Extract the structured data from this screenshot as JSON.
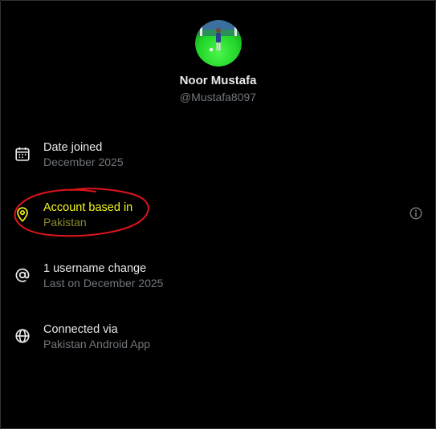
{
  "profile": {
    "name": "Noor Mustafa",
    "handle": "@Mustafa8097"
  },
  "rows": [
    {
      "icon": "calendar-icon",
      "title": "Date joined",
      "subtitle": "December 2025"
    },
    {
      "icon": "location-pin-icon",
      "title": "Account based in",
      "subtitle": "Pakistan",
      "info_icon": "info-icon"
    },
    {
      "icon": "at-sign-icon",
      "title": "1 username change",
      "subtitle": "Last on December 2025"
    },
    {
      "icon": "globe-icon",
      "title": "Connected via",
      "subtitle": "Pakistan Android App"
    }
  ],
  "colors": {
    "background": "#000000",
    "primary_text": "#e7e9ea",
    "secondary_text": "#71767b",
    "highlight_text": "#f7f720",
    "highlight_subtext": "#8a8a2c",
    "annotation_stroke": "#e0141b"
  }
}
